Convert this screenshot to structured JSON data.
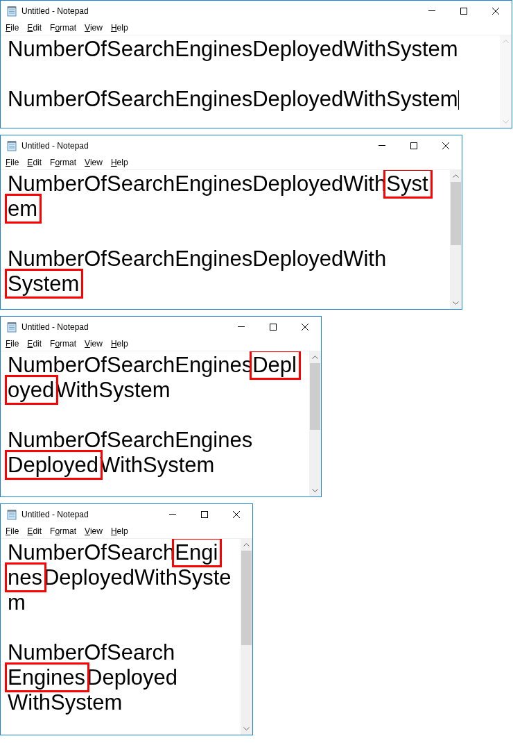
{
  "windows": [
    {
      "title": "Untitled - Notepad",
      "menu": [
        {
          "key": "F",
          "post": "ile"
        },
        {
          "key": "E",
          "post": "dit"
        },
        {
          "pre": "F",
          "key": "o",
          "post": "rmat"
        },
        {
          "key": "V",
          "post": "iew"
        },
        {
          "key": "H",
          "post": "elp"
        }
      ],
      "scrollable": false,
      "lines": [
        {
          "kind": "text",
          "caret": false,
          "segments": [
            {
              "text": "NumberOfSearchEnginesDeployedWithSystem",
              "highlighted": false
            }
          ]
        },
        {
          "kind": "blank"
        },
        {
          "kind": "text",
          "caret": true,
          "segments": [
            {
              "text": "NumberOfSearchEnginesDeployedWithSystem",
              "highlighted": false
            }
          ]
        }
      ]
    },
    {
      "title": "Untitled - Notepad",
      "menu": [
        {
          "key": "F",
          "post": "ile"
        },
        {
          "key": "E",
          "post": "dit"
        },
        {
          "pre": "F",
          "key": "o",
          "post": "rmat"
        },
        {
          "key": "V",
          "post": "iew"
        },
        {
          "key": "H",
          "post": "elp"
        }
      ],
      "scrollable": true,
      "lines": [
        {
          "kind": "text",
          "caret": false,
          "segments": [
            {
              "text": "NumberOfSearchEnginesDeployedWith",
              "highlighted": false
            },
            {
              "text": "Syst",
              "highlighted": true
            }
          ]
        },
        {
          "kind": "text",
          "caret": false,
          "segments": [
            {
              "text": "em",
              "highlighted": true
            }
          ]
        },
        {
          "kind": "blank"
        },
        {
          "kind": "text",
          "caret": false,
          "segments": [
            {
              "text": "NumberOfSearchEnginesDeployedWith",
              "highlighted": false
            }
          ]
        },
        {
          "kind": "text",
          "caret": false,
          "segments": [
            {
              "text": "System",
              "highlighted": true
            }
          ]
        }
      ]
    },
    {
      "title": "Untitled - Notepad",
      "menu": [
        {
          "key": "F",
          "post": "ile"
        },
        {
          "key": "E",
          "post": "dit"
        },
        {
          "pre": "F",
          "key": "o",
          "post": "rmat"
        },
        {
          "key": "V",
          "post": "iew"
        },
        {
          "key": "H",
          "post": "elp"
        }
      ],
      "scrollable": true,
      "lines": [
        {
          "kind": "text",
          "caret": false,
          "segments": [
            {
              "text": "NumberOfSearchEngines",
              "highlighted": false
            },
            {
              "text": "Depl",
              "highlighted": true
            }
          ]
        },
        {
          "kind": "text",
          "caret": false,
          "segments": [
            {
              "text": "oyed",
              "highlighted": true
            },
            {
              "text": "WithSystem",
              "highlighted": false
            }
          ]
        },
        {
          "kind": "blank"
        },
        {
          "kind": "text",
          "caret": false,
          "segments": [
            {
              "text": "NumberOfSearchEngines",
              "highlighted": false
            }
          ]
        },
        {
          "kind": "text",
          "caret": false,
          "segments": [
            {
              "text": "Deployed",
              "highlighted": true
            },
            {
              "text": "WithSystem",
              "highlighted": false
            }
          ]
        }
      ]
    },
    {
      "title": "Untitled - Notepad",
      "menu": [
        {
          "key": "F",
          "post": "ile"
        },
        {
          "key": "E",
          "post": "dit"
        },
        {
          "pre": "F",
          "key": "o",
          "post": "rmat"
        },
        {
          "key": "V",
          "post": "iew"
        },
        {
          "key": "H",
          "post": "elp"
        }
      ],
      "scrollable": true,
      "lines": [
        {
          "kind": "text",
          "caret": false,
          "segments": [
            {
              "text": "NumberOfSearch",
              "highlighted": false
            },
            {
              "text": "Engi",
              "highlighted": true
            }
          ]
        },
        {
          "kind": "text",
          "caret": false,
          "segments": [
            {
              "text": "nes",
              "highlighted": true
            },
            {
              "text": "DeployedWithSyste",
              "highlighted": false
            }
          ]
        },
        {
          "kind": "text",
          "caret": false,
          "segments": [
            {
              "text": "m",
              "highlighted": false
            }
          ]
        },
        {
          "kind": "blank"
        },
        {
          "kind": "text",
          "caret": false,
          "segments": [
            {
              "text": "NumberOfSearch",
              "highlighted": false
            }
          ]
        },
        {
          "kind": "text",
          "caret": false,
          "segments": [
            {
              "text": "Engines",
              "highlighted": true
            },
            {
              "text": "Deployed",
              "highlighted": false
            }
          ]
        },
        {
          "kind": "text",
          "caret": false,
          "segments": [
            {
              "text": "WithSystem",
              "highlighted": false
            }
          ]
        }
      ]
    }
  ]
}
